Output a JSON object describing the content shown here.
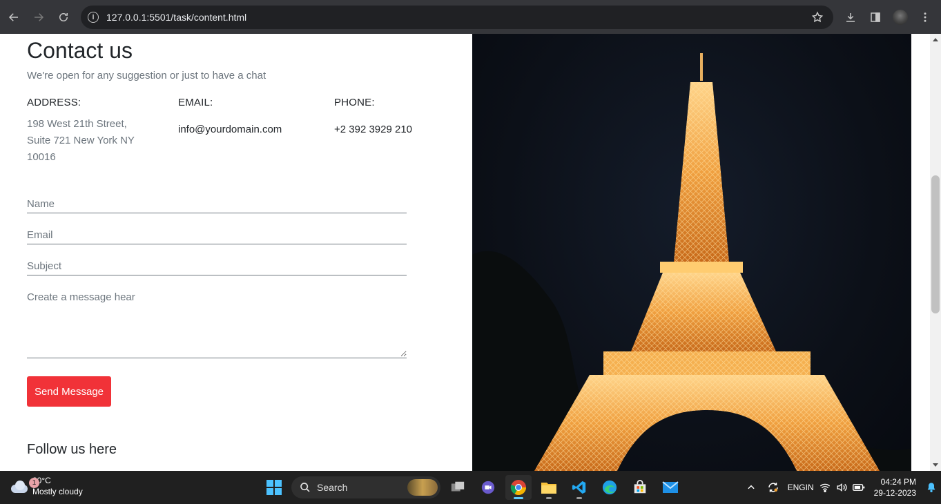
{
  "browser": {
    "url": "127.0.0.1:5501/task/content.html"
  },
  "contact": {
    "title": "Contact us",
    "subtitle": "We're open for any suggestion or just to have a chat",
    "address": {
      "label": "ADDRESS:",
      "value": "198 West 21th Street, Suite 721 New York NY 10016"
    },
    "email": {
      "label": "EMAIL:",
      "value": "info@yourdomain.com"
    },
    "phone": {
      "label": "PHONE:",
      "value": "+2 392 3929 210"
    }
  },
  "form": {
    "name_placeholder": "Name",
    "email_placeholder": "Email",
    "subject_placeholder": "Subject",
    "message_placeholder": "Create a message hear",
    "send_label": "Send Message"
  },
  "follow": {
    "heading": "Follow us here"
  },
  "colors": {
    "accent": "#f13238",
    "photo_background": "#0c1018",
    "tower_light": "#f0a040"
  },
  "taskbar": {
    "weather_badge": "1",
    "temperature": "30°C",
    "weather_desc": "Mostly cloudy",
    "search_label": "Search",
    "lang_line1": "ENG",
    "lang_line2": "IN",
    "time": "04:24 PM",
    "date": "29-12-2023"
  }
}
